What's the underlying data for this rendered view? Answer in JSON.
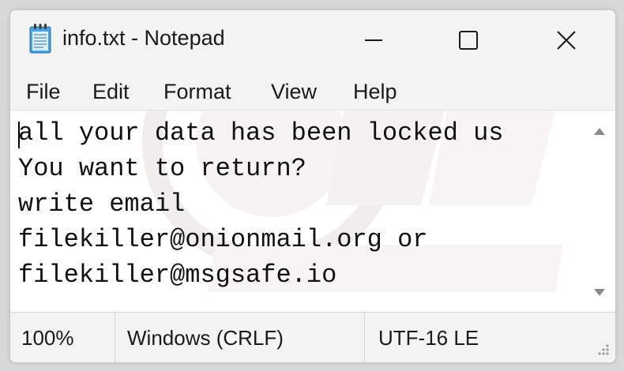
{
  "window": {
    "title": "info.txt - Notepad"
  },
  "titlebar_buttons": {
    "minimize_icon": "minimize-icon",
    "maximize_icon": "maximize-icon",
    "close_icon": "close-icon"
  },
  "menu": {
    "items": [
      "File",
      "Edit",
      "Format",
      "View",
      "Help"
    ]
  },
  "document": {
    "lines": [
      "all your data has been locked us",
      "You want to return?",
      "write email",
      "filekiller@onionmail.org or",
      "filekiller@msgsafe.io"
    ]
  },
  "statusbar": {
    "zoom": "100%",
    "line_ending": "Windows (CRLF)",
    "encoding": "UTF-16 LE"
  },
  "colors": {
    "chrome_bg": "#f3f3f3",
    "editor_bg": "#ffffff",
    "text": "#111111"
  }
}
